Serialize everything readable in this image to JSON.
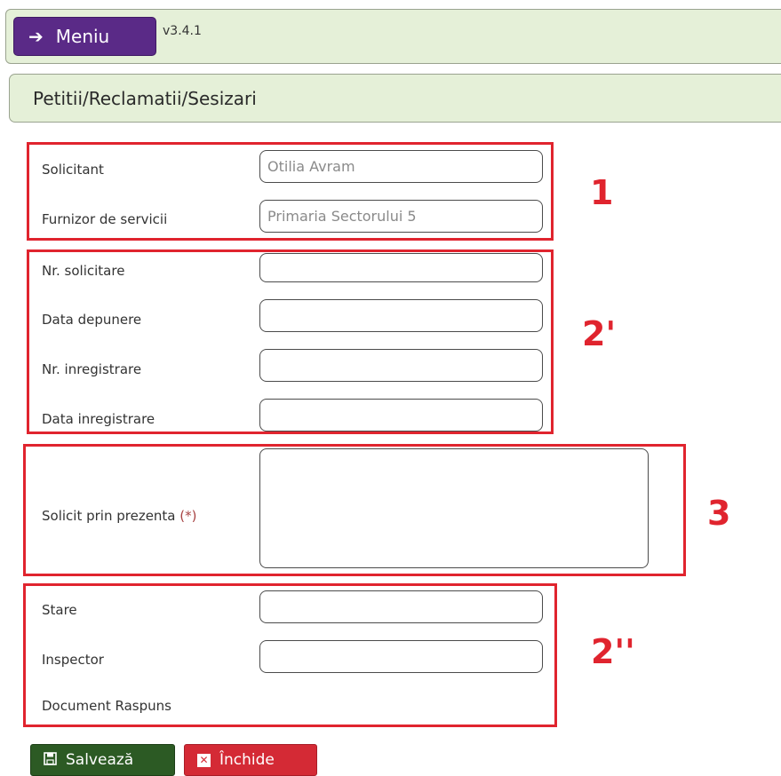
{
  "header": {
    "menu_label": "Meniu",
    "menu_icon": "arrow-right-icon",
    "version": "v3.4.1"
  },
  "page": {
    "title": "Petitii/Reclamatii/Sesizari"
  },
  "fields": {
    "solicitant": {
      "label": "Solicitant",
      "value": "Otilia Avram"
    },
    "furnizor": {
      "label": "Furnizor de servicii",
      "value": "Primaria Sectorului 5"
    },
    "nr_solicitare": {
      "label": "Nr. solicitare",
      "value": ""
    },
    "data_depunere": {
      "label": "Data depunere",
      "value": ""
    },
    "nr_inregistrare": {
      "label": "Nr. inregistrare",
      "value": ""
    },
    "data_inregistrare": {
      "label": "Data inregistrare",
      "value": ""
    },
    "solicit": {
      "label": "Solicit prin prezenta",
      "required_marker": "(*)",
      "value": ""
    },
    "stare": {
      "label": "Stare",
      "value": ""
    },
    "inspector": {
      "label": "Inspector",
      "value": ""
    },
    "document_raspuns": {
      "label": "Document Raspuns"
    }
  },
  "annotations": {
    "n1": "1",
    "n2a": "2'",
    "n3": "3",
    "n2b": "2''"
  },
  "buttons": {
    "save": "Salvează",
    "close": "Închide"
  },
  "colors": {
    "highlight": "#e0242e",
    "menu_bg": "#5a2a87",
    "bar_bg": "#e5f0d8",
    "save_bg": "#2c5a24",
    "close_bg": "#d42a35"
  }
}
